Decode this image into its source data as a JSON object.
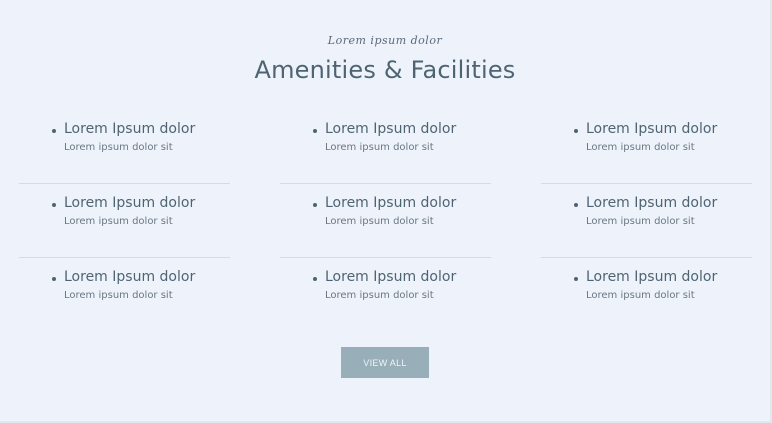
{
  "header": {
    "script_title": "Lorem ipsum dolor",
    "title": "Amenities & Facilities"
  },
  "amenities": [
    [
      {
        "title": "Lorem Ipsum dolor",
        "subtitle": "Lorem ipsum dolor sit"
      },
      {
        "title": "Lorem Ipsum dolor",
        "subtitle": "Lorem ipsum dolor sit"
      },
      {
        "title": "Lorem Ipsum dolor",
        "subtitle": "Lorem ipsum dolor sit"
      }
    ],
    [
      {
        "title": "Lorem Ipsum dolor",
        "subtitle": "Lorem ipsum dolor sit"
      },
      {
        "title": "Lorem Ipsum dolor",
        "subtitle": "Lorem ipsum dolor sit"
      },
      {
        "title": "Lorem Ipsum dolor",
        "subtitle": "Lorem ipsum dolor sit"
      }
    ],
    [
      {
        "title": "Lorem Ipsum dolor",
        "subtitle": "Lorem ipsum dolor sit"
      },
      {
        "title": "Lorem Ipsum dolor",
        "subtitle": "Lorem ipsum dolor sit"
      },
      {
        "title": "Lorem Ipsum dolor",
        "subtitle": "Lorem ipsum dolor sit"
      }
    ]
  ],
  "button": {
    "view_all_label": "VIEW ALL"
  },
  "colors": {
    "background": "#eef2fb",
    "heading": "#4f6472",
    "button_bg": "#98aeb8"
  }
}
